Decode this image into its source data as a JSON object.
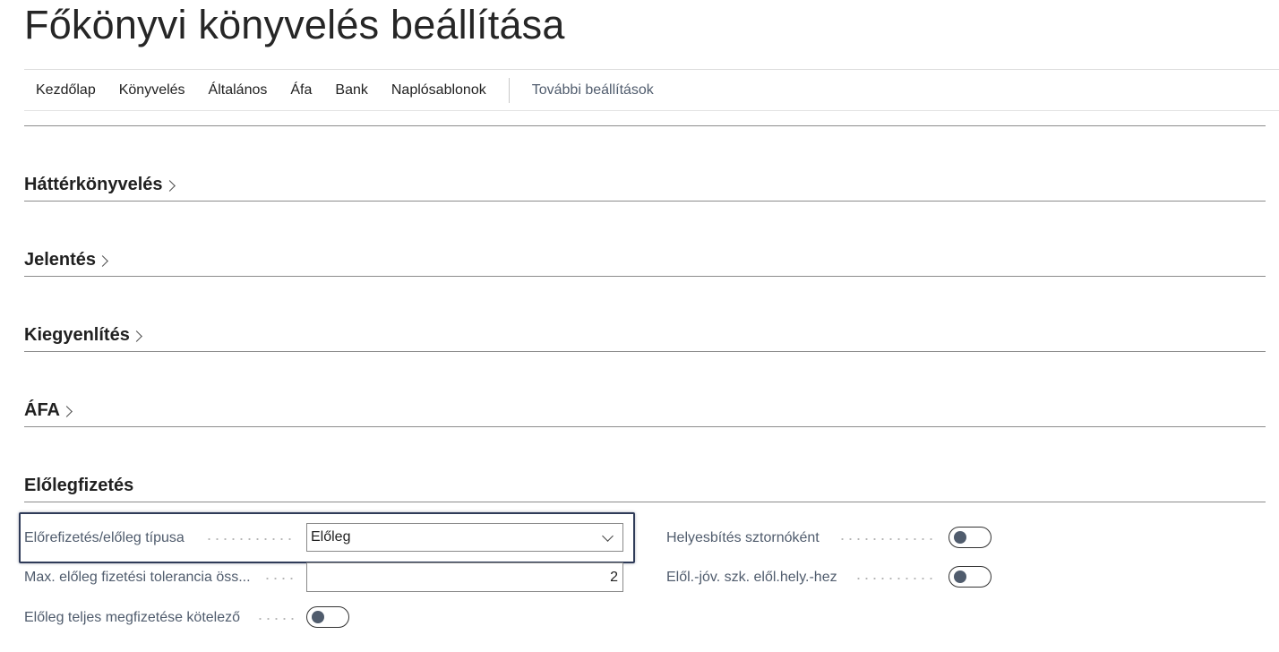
{
  "page": {
    "title": "Főkönyvi könyvelés beállítása"
  },
  "actions": {
    "items": [
      "Kezdőlap",
      "Könyvelés",
      "Általános",
      "Áfa",
      "Bank",
      "Naplósablonok"
    ],
    "more": "További beállítások"
  },
  "sections": {
    "background_posting": "Háttérkönyvelés",
    "reporting": "Jelentés",
    "application": "Kiegyenlítés",
    "vat": "ÁFA",
    "prepayment": "Előlegfizetés"
  },
  "prepayment": {
    "type_label": "Előrefizetés/előleg típusa",
    "type_value": "Előleg",
    "tolerance_label": "Max. előleg fizetési tolerancia öss...",
    "tolerance_value": "2",
    "mandatory_label": "Előleg teljes megfizetése kötelező",
    "mandatory_value": false,
    "correction_label": "Helyesbítés sztornóként",
    "correction_value": false,
    "credit_memo_label": "Elől.-jóv. szk. elől.hely.-hez",
    "credit_memo_value": false
  }
}
